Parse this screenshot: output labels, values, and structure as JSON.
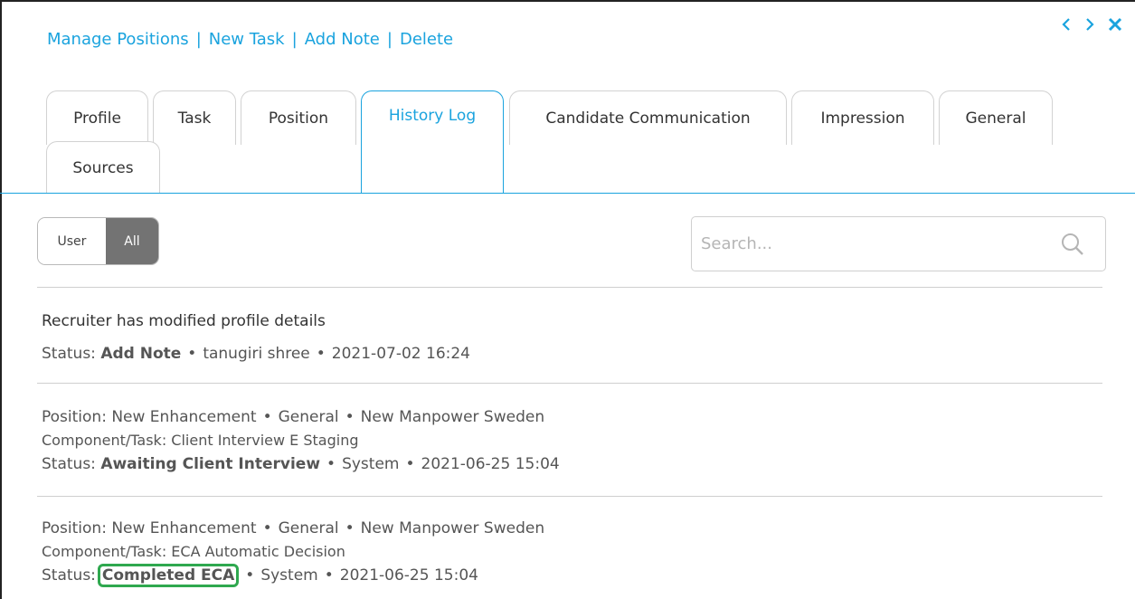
{
  "actions": {
    "manage_positions": "Manage Positions",
    "new_task": "New Task",
    "add_note": "Add Note",
    "delete": "Delete",
    "separator": "|"
  },
  "nav_icons": [
    "chevron-left-icon",
    "chevron-right-icon",
    "close-icon"
  ],
  "tabs": [
    {
      "label": "Profile"
    },
    {
      "label": "Task"
    },
    {
      "label": "Position"
    },
    {
      "label": "History Log"
    },
    {
      "label": "Candidate Communication"
    },
    {
      "label": "Impression"
    },
    {
      "label": "General"
    },
    {
      "label": "Sources"
    }
  ],
  "active_tab": "History Log",
  "filter": {
    "user_label": "User",
    "all_label": "All",
    "selected": "All"
  },
  "search": {
    "placeholder": "Search..."
  },
  "history": [
    {
      "title": "Recruiter has modified profile details",
      "status_label": "Status:",
      "status": "Add Note",
      "by": "tanugiri shree",
      "timestamp": "2021-07-02 16:24"
    },
    {
      "position_line": "Position: New Enhancement",
      "position_type": "General",
      "company": "New Manpower Sweden",
      "component": "Component/Task: Client Interview E Staging",
      "status_label": "Status:",
      "status": "Awaiting Client Interview",
      "by": "System",
      "timestamp": "2021-06-25 15:04"
    },
    {
      "position_line": "Position: New Enhancement",
      "position_type": "General",
      "company": "New Manpower Sweden",
      "component": "Component/Task: ECA Automatic Decision",
      "status_label": "Status:",
      "status": "Completed ECA",
      "by": "System",
      "timestamp": "2021-06-25 15:04"
    }
  ],
  "bullet": "•",
  "colors": {
    "accent": "#1aa3de",
    "toggle_active": "#737373",
    "highlight": "#2fa84f"
  }
}
